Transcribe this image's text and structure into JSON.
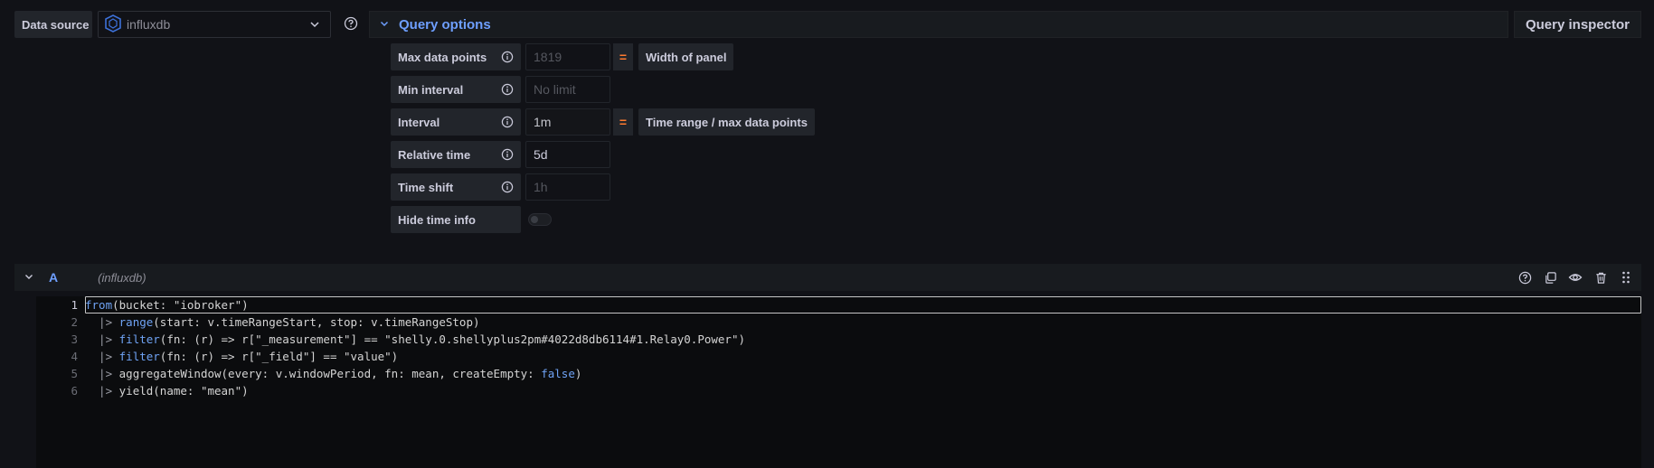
{
  "data_source": {
    "label": "Data source",
    "selected": "influxdb",
    "icon": "influxdb-logo-icon"
  },
  "query_options": {
    "title": "Query options",
    "rows": [
      {
        "label": "Max data points",
        "value": "1819",
        "value_style": "placeholder",
        "eq": "=",
        "eq_desc": "Width of panel"
      },
      {
        "label": "Min interval",
        "value": "No limit",
        "value_style": "placeholder"
      },
      {
        "label": "Interval",
        "value": "1m",
        "value_style": "value-dim",
        "eq": "=",
        "eq_desc": "Time range / max data points"
      },
      {
        "label": "Relative time",
        "value": "5d",
        "value_style": "value"
      },
      {
        "label": "Time shift",
        "value": "1h",
        "value_style": "placeholder"
      },
      {
        "label": "Hide time info",
        "toggle": false
      }
    ]
  },
  "query_inspector": {
    "label": "Query inspector"
  },
  "query": {
    "letter": "A",
    "datasource": "(influxdb)",
    "actions": [
      "help-icon",
      "duplicate-icon",
      "eye-icon",
      "trash-icon",
      "drag-handle-icon"
    ]
  },
  "editor": {
    "active_line": 1,
    "lines": [
      {
        "num": "1",
        "parts": [
          {
            "t": "from",
            "c": "kw"
          },
          {
            "t": "(bucket: \"iobroker\")"
          }
        ]
      },
      {
        "num": "2",
        "parts": [
          {
            "t": "  |> ",
            "c": "pipe"
          },
          {
            "t": "range",
            "c": "kw"
          },
          {
            "t": "(start: v.timeRangeStart, stop: v.timeRangeStop)"
          }
        ]
      },
      {
        "num": "3",
        "parts": [
          {
            "t": "  |> ",
            "c": "pipe"
          },
          {
            "t": "filter",
            "c": "kw"
          },
          {
            "t": "(fn: (r) => r[\"_measurement\"] == \"shelly.0.shellyplus2pm#4022d8db6114#1.Relay0.Power\")"
          }
        ]
      },
      {
        "num": "4",
        "parts": [
          {
            "t": "  |> ",
            "c": "pipe"
          },
          {
            "t": "filter",
            "c": "kw"
          },
          {
            "t": "(fn: (r) => r[\"_field\"] == \"value\")"
          }
        ]
      },
      {
        "num": "5",
        "parts": [
          {
            "t": "  |> ",
            "c": "pipe"
          },
          {
            "t": "aggregateWindow(every: v.windowPeriod, fn: mean, createEmpty: "
          },
          {
            "t": "false",
            "c": "bool"
          },
          {
            "t": ")"
          }
        ]
      },
      {
        "num": "6",
        "parts": [
          {
            "t": "  |> ",
            "c": "pipe"
          },
          {
            "t": "yield(name: \"mean\")"
          }
        ]
      }
    ]
  },
  "colors": {
    "accent": "#6e9fff",
    "equals": "#ff7a2f",
    "background": "#111217"
  }
}
